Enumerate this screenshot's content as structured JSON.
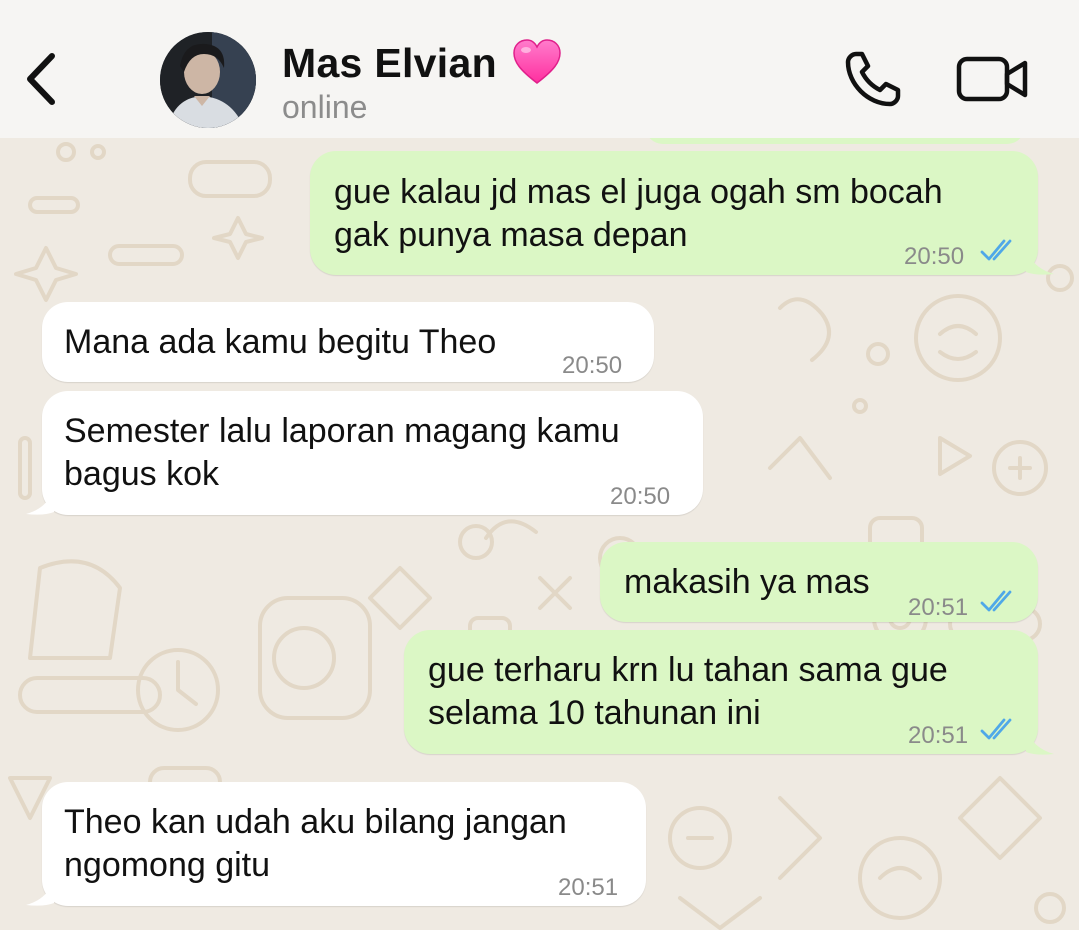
{
  "header": {
    "contact_name": "Mas Elvian",
    "status": "online",
    "icons": [
      "back-chevron-icon",
      "pink-heart-icon",
      "phone-icon",
      "video-camera-icon"
    ]
  },
  "colors": {
    "header_bg": "#f6f5f3",
    "chat_bg": "#efeae2",
    "outgoing_bubble": "#dbf7c5",
    "incoming_bubble": "#ffffff",
    "read_ticks": "#4fa8e8",
    "heart": "#ff4fb0"
  },
  "messages": [
    {
      "direction": "out",
      "lines": [
        "gue kalau jd mas el juga ogah sm bocah",
        "gak punya masa depan"
      ],
      "time": "20:50",
      "read": true
    },
    {
      "direction": "in",
      "lines": [
        "Mana ada kamu begitu Theo"
      ],
      "time": "20:50"
    },
    {
      "direction": "in",
      "lines": [
        "Semester lalu laporan magang kamu",
        "bagus kok"
      ],
      "time": "20:50"
    },
    {
      "direction": "out",
      "lines": [
        "makasih ya mas"
      ],
      "time": "20:51",
      "read": true
    },
    {
      "direction": "out",
      "lines": [
        "gue terharu krn lu tahan sama gue",
        "selama 10 tahunan ini"
      ],
      "time": "20:51",
      "read": true
    },
    {
      "direction": "in",
      "lines": [
        "Theo kan udah aku bilang jangan",
        "ngomong gitu"
      ],
      "time": "20:51"
    }
  ]
}
